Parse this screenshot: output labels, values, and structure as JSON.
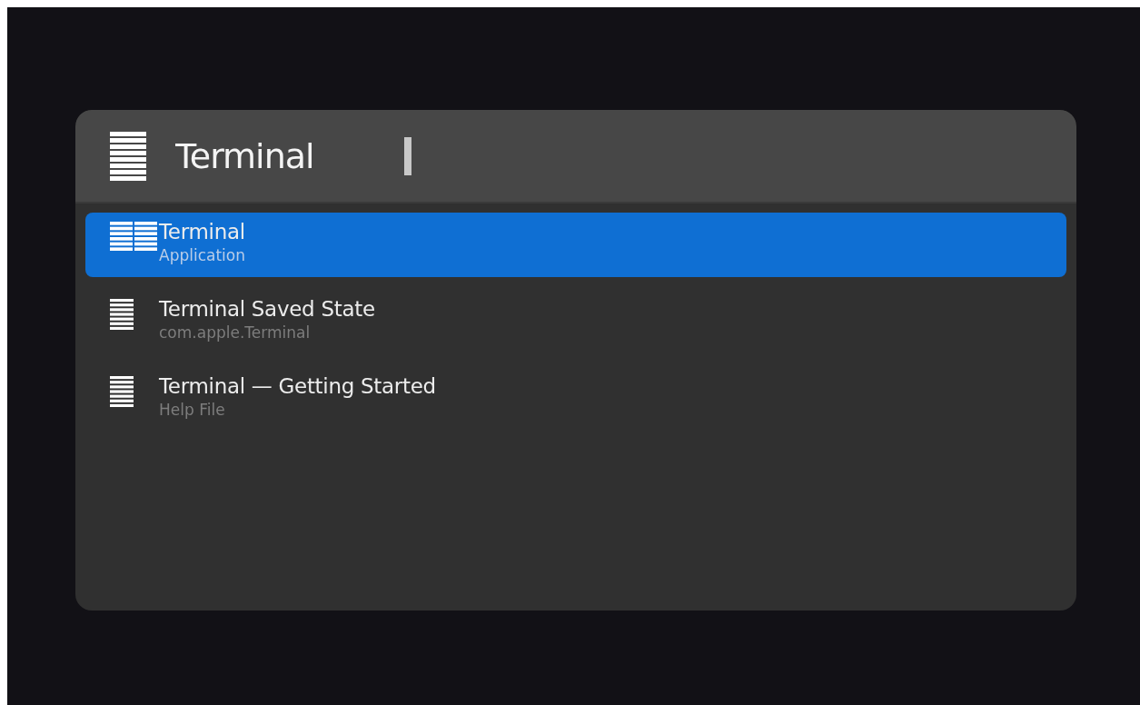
{
  "search": {
    "value": "Terminal"
  },
  "results": [
    {
      "title": "Terminal",
      "subtitle": "Application",
      "kind": "app",
      "selected": true
    },
    {
      "title": "Terminal Saved State",
      "subtitle": "com.apple.Terminal",
      "kind": "document",
      "selected": false
    },
    {
      "title": "Terminal — Getting Started",
      "subtitle": "Help File",
      "kind": "document",
      "selected": false
    }
  ]
}
